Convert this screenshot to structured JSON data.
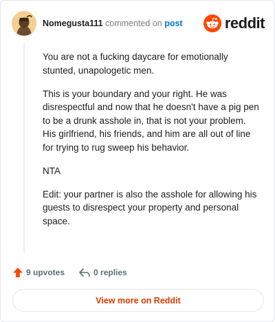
{
  "comment": {
    "author": "Nomegusta111",
    "action_text": "commented on",
    "post_link": "post",
    "paragraphs": [
      "You are not a fucking daycare for emotionally stunted, unapologetic men.",
      "This is your boundary and your right. He was disrespectful and now that he doesn't have a pig pen to be a drunk asshole in, that is not your problem. His girlfriend, his friends, and him are all out of line for trying to rug sweep his behavior.",
      "NTA",
      "Edit: your partner is also the asshole for allowing his guests to disrespect your property and personal space."
    ]
  },
  "brand": {
    "wordmark": "reddit",
    "icon": "reddit-snoo-icon"
  },
  "actions": {
    "upvotes": "9 upvotes",
    "replies": "0 replies",
    "upvote_icon": "upvote-arrow-icon",
    "reply_icon": "reply-arrow-icon"
  },
  "footer": {
    "view_more": "View more on Reddit"
  },
  "colors": {
    "brand_orange": "#ff4500",
    "link_blue": "#0079d3",
    "button_text": "#d93a00",
    "muted_text": "#576f76"
  }
}
